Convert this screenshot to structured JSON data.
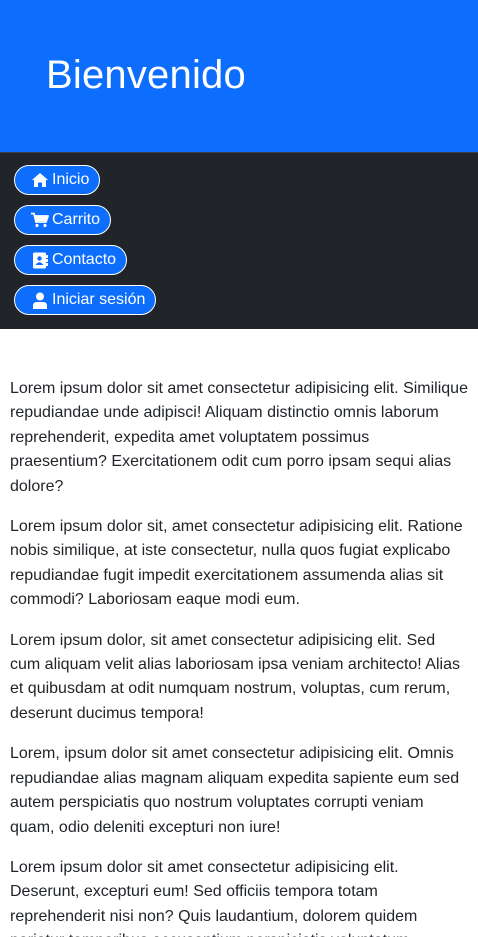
{
  "header": {
    "title": "Bienvenido"
  },
  "nav": {
    "items": [
      {
        "label": "Inicio",
        "icon": "home-icon"
      },
      {
        "label": "Carrito",
        "icon": "cart-icon"
      },
      {
        "label": "Contacto",
        "icon": "address-book-icon"
      },
      {
        "label": "Iniciar sesión",
        "icon": "user-icon"
      }
    ]
  },
  "content": {
    "paragraphs": [
      "Lorem ipsum dolor sit amet consectetur adipisicing elit. Similique repudiandae unde adipisci! Aliquam distinctio omnis laborum reprehenderit, expedita amet voluptatem possimus praesentium? Exercitationem odit cum porro ipsam sequi alias dolore?",
      "Lorem ipsum dolor sit, amet consectetur adipisicing elit. Ratione nobis similique, at iste consectetur, nulla quos fugiat explicabo repudiandae fugit impedit exercitationem assumenda alias sit commodi? Laboriosam eaque modi eum.",
      "Lorem ipsum dolor, sit amet consectetur adipisicing elit. Sed cum aliquam velit alias laboriosam ipsa veniam architecto! Alias et quibusdam at odit numquam nostrum, voluptas, cum rerum, deserunt ducimus tempora!",
      "Lorem, ipsum dolor sit amet consectetur adipisicing elit. Omnis repudiandae alias magnam aliquam expedita sapiente eum sed autem perspiciatis quo nostrum voluptates corrupti veniam quam, odio deleniti excepturi non iure!",
      "Lorem ipsum dolor sit amet consectetur adipisicing elit. Deserunt, excepturi eum! Sed officiis tempora totam reprehenderit nisi non? Quis laudantium, dolorem quidem pariatur temporibus accusantium perspiciatis voluptatum"
    ]
  },
  "colors": {
    "primary": "#0d6efd",
    "navbar": "#212529",
    "text": "#212529"
  }
}
